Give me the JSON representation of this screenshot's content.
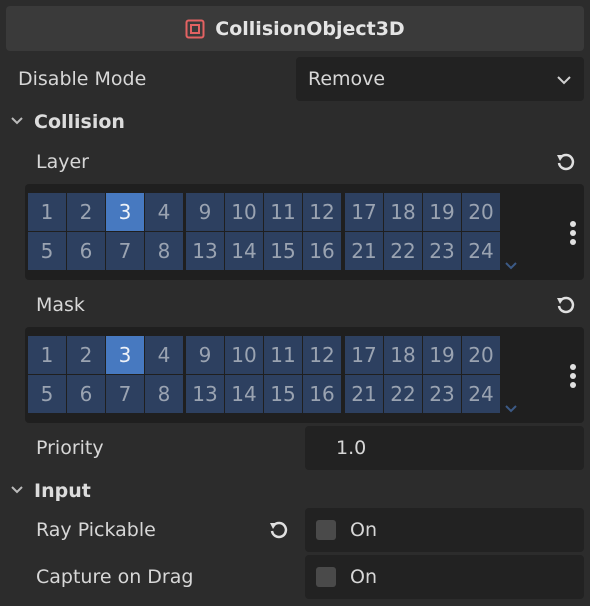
{
  "header": {
    "title": "CollisionObject3D",
    "icon": "collision-object-icon",
    "icon_color": "#e36262"
  },
  "disable_mode": {
    "label": "Disable Mode",
    "value": "Remove"
  },
  "collision_section": {
    "title": "Collision"
  },
  "layer": {
    "label": "Layer",
    "groups": [
      [
        "1",
        "2",
        "3",
        "4",
        "5",
        "6",
        "7",
        "8"
      ],
      [
        "9",
        "10",
        "11",
        "12",
        "13",
        "14",
        "15",
        "16"
      ],
      [
        "17",
        "18",
        "19",
        "20",
        "21",
        "22",
        "23",
        "24"
      ]
    ],
    "active": [
      "3"
    ]
  },
  "mask": {
    "label": "Mask",
    "groups": [
      [
        "1",
        "2",
        "3",
        "4",
        "5",
        "6",
        "7",
        "8"
      ],
      [
        "9",
        "10",
        "11",
        "12",
        "13",
        "14",
        "15",
        "16"
      ],
      [
        "17",
        "18",
        "19",
        "20",
        "21",
        "22",
        "23",
        "24"
      ]
    ],
    "active": [
      "3"
    ]
  },
  "priority": {
    "label": "Priority",
    "value": "1.0"
  },
  "input_section": {
    "title": "Input"
  },
  "ray_pickable": {
    "label": "Ray Pickable",
    "value": "On",
    "checked": false
  },
  "capture_on_drag": {
    "label": "Capture on Drag",
    "value": "On",
    "checked": false
  },
  "colors": {
    "cell": "#2d4060",
    "cell_active": "#4779c0",
    "panel": "#1f1f1f"
  }
}
